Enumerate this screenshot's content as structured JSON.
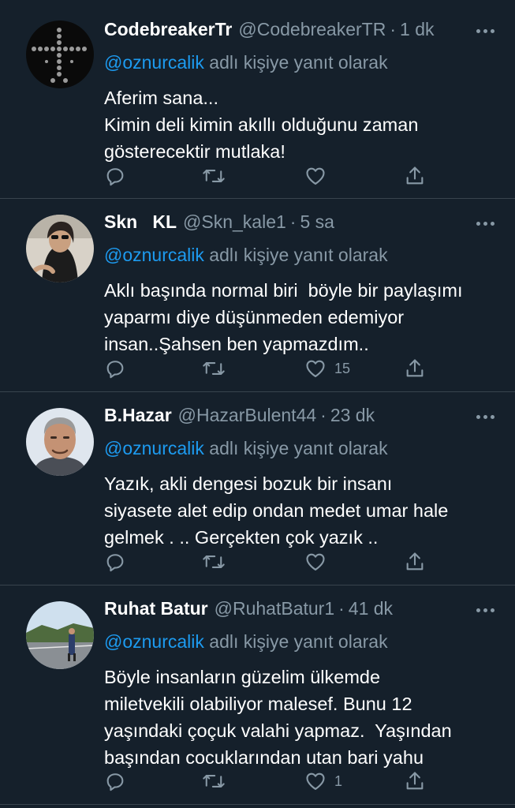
{
  "tweets": [
    {
      "name": "CodebreakerTr",
      "handle": "@CodebreakerTR",
      "dot": "·",
      "time": "1 dk",
      "reply_mention": "@oznurcalik",
      "reply_suffix": "adlı kişiye yanıt olarak",
      "body_lines": [
        "Aferim sana...",
        "Kimin deli kimin akıllı olduğunu zaman",
        "gösterecektir mutlaka!"
      ],
      "like_count": ""
    },
    {
      "name": "Skn   KL",
      "handle": "@Skn_kale1",
      "dot": "·",
      "time": "5 sa",
      "reply_mention": "@oznurcalik",
      "reply_suffix": "adlı kişiye yanıt olarak",
      "body_lines": [
        "Aklı başında normal biri  böyle bir paylaşımı",
        "yaparmı diye düşünmeden edemiyor",
        "insan..Şahsen ben yapmazdım.."
      ],
      "like_count": "15"
    },
    {
      "name": "B.Hazar",
      "handle": "@HazarBulent44",
      "dot": "·",
      "time": "23 dk",
      "reply_mention": "@oznurcalik",
      "reply_suffix": "adlı kişiye yanıt olarak",
      "body_lines": [
        "Yazık, akli dengesi bozuk bir insanı",
        "siyasete alet edip ondan medet umar hale",
        "gelmek . .. Gerçekten çok yazık .."
      ],
      "like_count": ""
    },
    {
      "name": "Ruhat Batur",
      "handle": "@RuhatBatur1",
      "dot": "·",
      "time": "41 dk",
      "reply_mention": "@oznurcalik",
      "reply_suffix": "adlı kişiye yanıt olarak",
      "body_lines": [
        "Böyle insanların güzelim ülkemde",
        "miletvekili olabiliyor malesef. Bunu 12",
        "yaşındaki çoçuk valahi yapmaz.  Yaşından",
        "başından cocuklarından utan bari yahu"
      ],
      "like_count": "1"
    }
  ],
  "colors": {
    "background": "#15202b",
    "divider": "#38444d",
    "secondary_text": "#8899a6",
    "mention": "#1d9bf0"
  },
  "icons": [
    "reply-icon",
    "retweet-icon",
    "like-icon",
    "share-icon",
    "more-icon"
  ]
}
